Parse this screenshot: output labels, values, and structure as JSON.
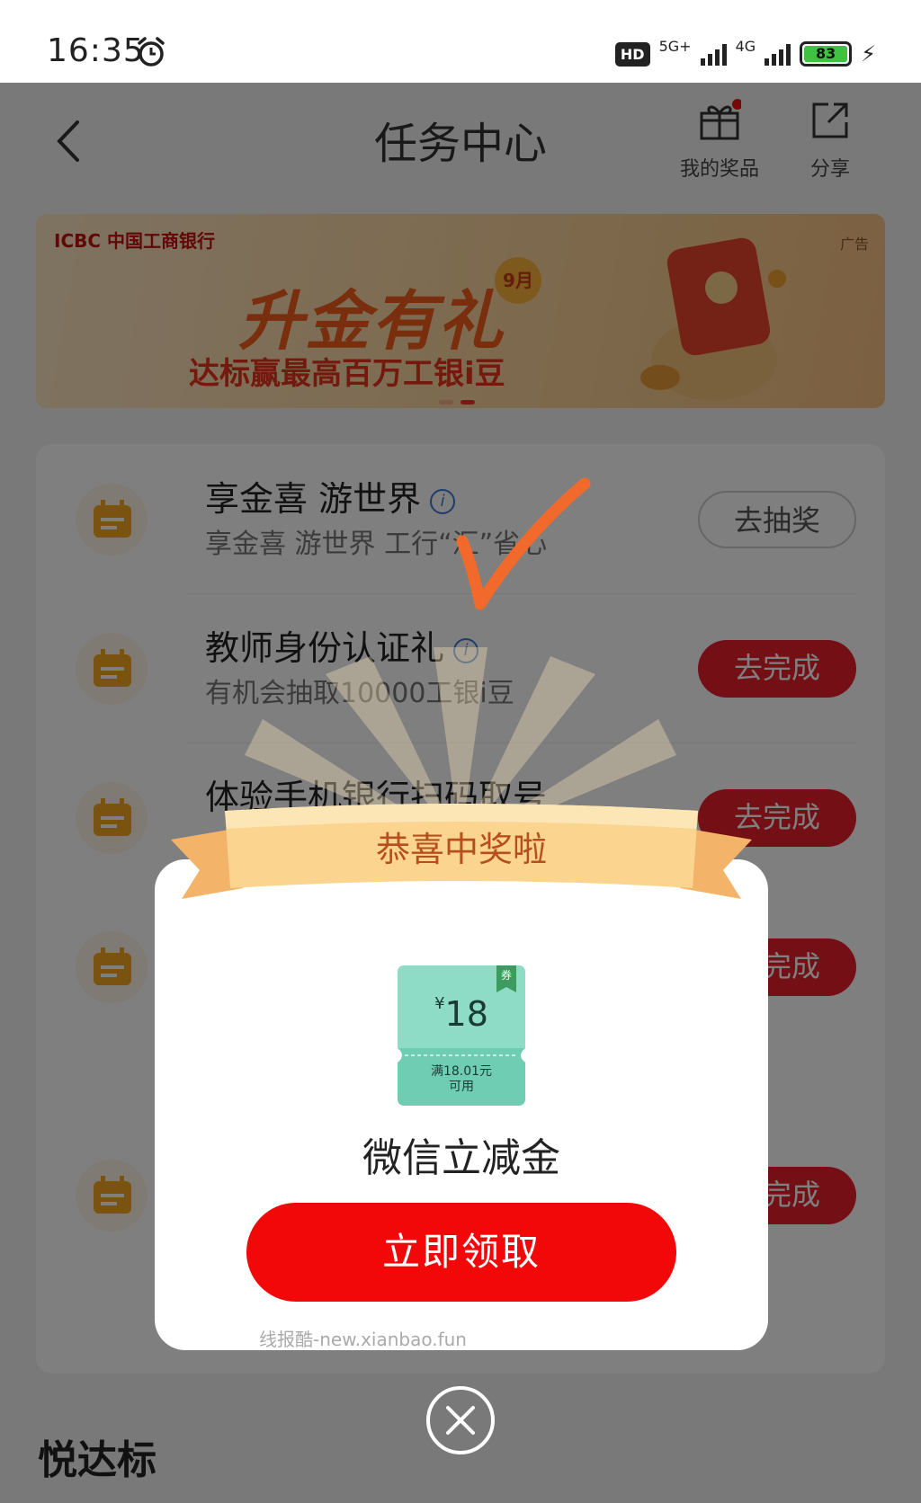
{
  "status_bar": {
    "time": "16:35",
    "hd_label": "HD",
    "net1": "5G+",
    "net2": "4G",
    "battery": "83"
  },
  "header": {
    "title": "任务中心",
    "prizes_label": "我的奖品",
    "share_label": "分享"
  },
  "banner": {
    "bank": "ICBC 中国工商银行",
    "ad_tag": "广告",
    "title": "升金有礼",
    "month": "9月",
    "subtitle": "达标赢最高百万工银i豆"
  },
  "tasks": [
    {
      "name": "享金喜 游世界",
      "desc": "享金喜 游世界 工行“汇”省心",
      "button": "去抽奖",
      "style": "outline"
    },
    {
      "name": "教师身份认证礼",
      "desc": "有机会抽取10000工银i豆",
      "button": "去完成",
      "style": "solid"
    },
    {
      "name": "体验手机银行扫码取号",
      "desc": "",
      "button": "去完成",
      "style": "solid"
    },
    {
      "name": "",
      "desc": "",
      "button": "去完成",
      "style": "solid"
    },
    {
      "name": "",
      "desc": "",
      "button": "去完成",
      "style": "solid"
    }
  ],
  "section_title": "悦达标",
  "modal": {
    "ribbon": "恭喜中奖啦",
    "coupon_currency": "¥",
    "coupon_amount": "18",
    "coupon_condition_1": "满18.01元",
    "coupon_condition_2": "可用",
    "coupon_tag": "券",
    "prize_name": "微信立减金",
    "claim_button": "立即领取",
    "watermark": "线报酷-new.xianbao.fun"
  },
  "colors": {
    "accent_red": "#e8202a",
    "claim_red": "#f20808",
    "coupon_green": "#5fc3aa",
    "check_orange": "#f26a2b"
  }
}
